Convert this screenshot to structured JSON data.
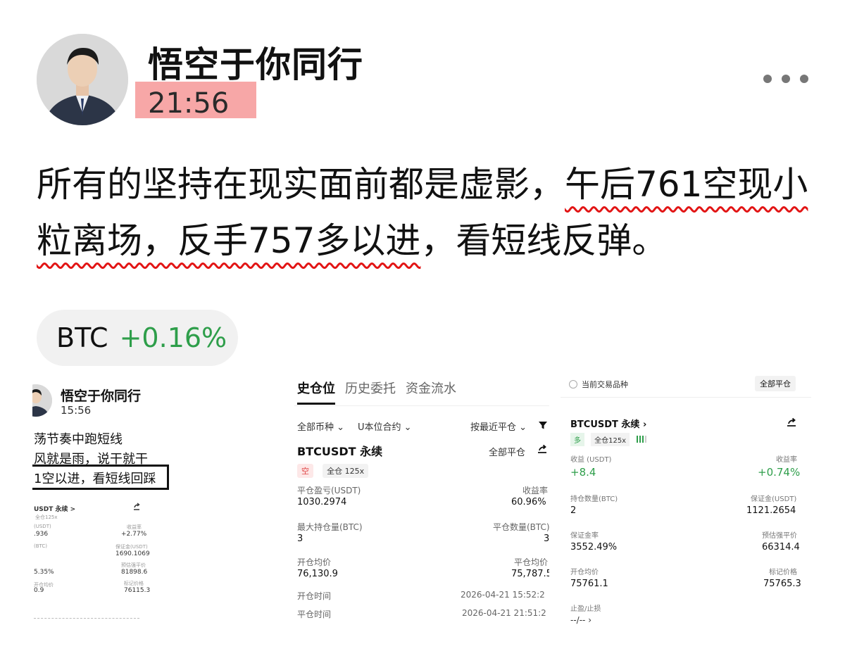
{
  "post": {
    "author": "悟空于你同行",
    "time": "21:56",
    "body_plain_1": "所有的坚持在现实面前都是虚影，",
    "body_hl_1": "午后761空现小粒离场，反手757多以进",
    "body_plain_2": "，看短线反弹。"
  },
  "ticker": {
    "symbol": "BTC",
    "change": "+0.16%"
  },
  "panel1": {
    "author": "悟空于你同行",
    "time": "15:56",
    "line1": "荡节奏中跑短线",
    "line2": "风就是雨，说干就干",
    "line3": "1空以进，看短线回踩",
    "symbol": "USDT 永续 >",
    "badge": "全仓125x",
    "pnl_label": "(USDT)",
    "pnl": ".936",
    "rate_label": "收益率",
    "rate": "+2.77%",
    "qty_label": "(BTC)",
    "margin_label": "保证金(USDT)",
    "margin": "1690.1069",
    "ratio": "5.35%",
    "liq_label": "预估强平价",
    "liq": "81898.6",
    "open_label": "开仓均价",
    "open": "0.9",
    "mark_label": "标记价格",
    "mark": "76115.3"
  },
  "panel2": {
    "tabs": [
      "史仓位",
      "历史委托",
      "资金流水"
    ],
    "filter_all": "全部币种",
    "filter_contract": "U本位合约",
    "sort": "按最近平仓",
    "symbol": "BTCUSDT 永续",
    "close_all": "全部平仓",
    "side_tag": "空",
    "mode_tag": "全仓 125x",
    "pnl_label": "平仓盈亏(USDT)",
    "pnl": "1030.2974",
    "rate_label": "收益率",
    "rate": "60.96%",
    "maxqty_label": "最大持仓量(BTC)",
    "maxqty": "3",
    "closeqty_label": "平仓数量(BTC)",
    "closeqty": "3",
    "open_label": "开仓均价",
    "open": "76,130.9",
    "close_label": "平仓均价",
    "close": "75,787.5",
    "opentime_label": "开仓时间",
    "opentime": "2026-04-21 15:52:2",
    "closetime_label": "平仓时间",
    "closetime": "2026-04-21 21:51:2"
  },
  "panel3": {
    "radio_label": "当前交易品种",
    "close_all": "全部平仓",
    "symbol": "BTCUSDT 永续",
    "side_tag": "多",
    "mode_tag": "全仓125x",
    "pnl_label": "收益 (USDT)",
    "pnl": "+8.4",
    "rate_label": "收益率",
    "rate": "+0.74%",
    "qty_label": "持仓数量(BTC)",
    "qty": "2",
    "margin_label": "保证金(USDT)",
    "margin": "1121.2654",
    "ratio_label": "保证金率",
    "ratio": "3552.49%",
    "liq_label": "预估强平价",
    "liq": "66314.4",
    "open_label": "开仓均价",
    "open": "75761.1",
    "mark_label": "标记价格",
    "mark": "75765.3",
    "tpsl_label": "止盈/止损",
    "tpsl": "--/--"
  },
  "colors": {
    "positive": "#2e9e4a",
    "highlight_time": "#f7a7a7",
    "underline": "#e21515",
    "sell_tag_bg": "#fde8e8",
    "sell_tag_fg": "#e04545",
    "buy_tag_bg": "#e6f5ea",
    "buy_tag_fg": "#2e9e4a"
  },
  "icons": [
    "person-avatar-icon",
    "more-dots-icon",
    "share-icon",
    "chevron-down-icon",
    "filter-icon",
    "radio-icon"
  ]
}
